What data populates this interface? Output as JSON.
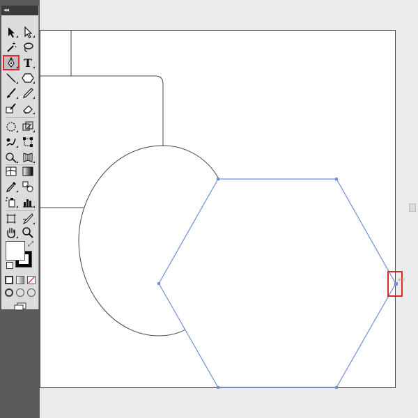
{
  "toolbar": {
    "collapse_glyph": "◂◂",
    "type_tool_glyph": "T",
    "selected_tool": "pen-tool",
    "tools": [
      "selection-tool",
      "direct-selection-tool",
      "magic-wand-tool",
      "lasso-tool",
      "pen-tool",
      "type-tool",
      "line-segment-tool",
      "polygon-tool",
      "paintbrush-tool",
      "pencil-tool",
      "blob-brush-tool",
      "eraser-tool",
      "rotate-tool",
      "scale-tool",
      "warp-tool",
      "free-transform-tool",
      "shape-builder-tool",
      "perspective-grid-tool",
      "mesh-tool",
      "gradient-tool",
      "eyedropper-tool",
      "blend-tool",
      "symbol-sprayer-tool",
      "column-graph-tool",
      "artboard-tool",
      "slice-tool",
      "hand-tool",
      "zoom-tool"
    ]
  },
  "swatches": {
    "fill_color": "#ffffff",
    "stroke_color": "#000000"
  },
  "canvas": {
    "anchor_label": "anc",
    "path_color": "#6f8fd6",
    "shape_stroke": "#444444",
    "highlight_color": "#e0262c"
  }
}
